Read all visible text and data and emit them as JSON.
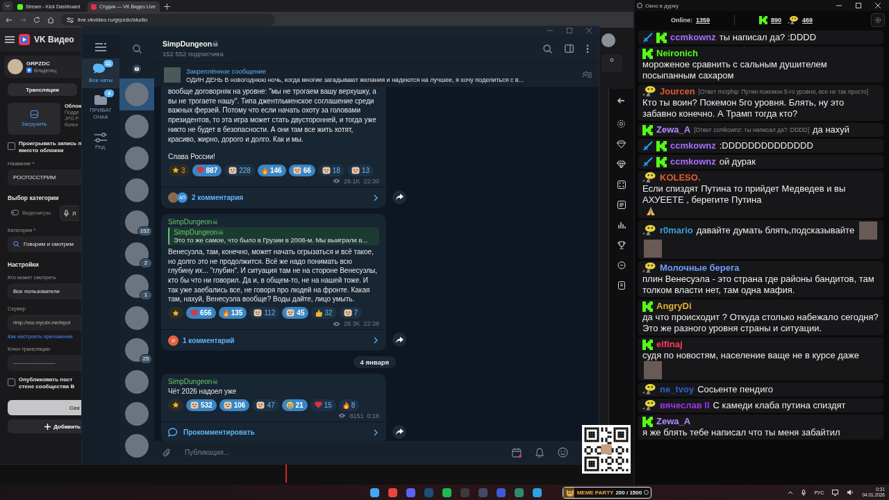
{
  "browser": {
    "tabs": [
      {
        "title": "Stream - Kick Dashboard",
        "selected": false,
        "kind": "kick"
      },
      {
        "title": "Студия — VK Видео Live",
        "selected": true,
        "kind": "vk"
      }
    ],
    "url": "live.vkvideo.ru/grpzdc/studio",
    "studio": {
      "brand": "VK Видео",
      "channel": "GRPZDC",
      "role": "Владелец",
      "section_tab": "Трансляции",
      "upload": "Загрузить",
      "cover_title": "Облож",
      "cover_hint": [
        "Подде",
        "JPG Р",
        "более"
      ],
      "play_recording": {
        "lines": [
          "Проигрывать запись п",
          "вместо обложки"
        ],
        "checked": false
      },
      "name_label": "Название *",
      "name_value": "РОСГОССТРИМ",
      "category_heading": "Выбор категории",
      "category_tabs": [
        {
          "label": "Видеоигры",
          "kind": "games",
          "selected": false
        },
        {
          "label": "Л",
          "kind": "live",
          "selected": true
        }
      ],
      "category_label": "Категория *",
      "category_value": "Говорим и смотрим",
      "settings_heading": "Настройки",
      "who_label": "Кто может смотреть",
      "who_value": "Все пользователи",
      "server_label": "Сервер",
      "server_value": "rtmp://vsu.mycdn.me/input",
      "help_link": "Как настроить приложение",
      "key_label": "Ключ трансляции",
      "key_value": "--------------------------",
      "publish": {
        "lines": [
          "Опубликовать пост",
          "стене сообщества В"
        ],
        "checked": false
      },
      "save_button": "Сох",
      "add_button": "Добавить"
    },
    "side_counter": "0"
  },
  "telegram": {
    "folders": [
      {
        "label": "Все чаты",
        "badge": "11",
        "kind": "chats",
        "selected": true
      },
      {
        "label": "ПРИВАТ ОЧКА",
        "badge": "4",
        "kind": "folder",
        "selected": false
      },
      {
        "label": "Ред.",
        "kind": "edit",
        "selected": false
      }
    ],
    "chats": [
      {
        "selected": true
      },
      {
        "selected": false
      },
      {
        "selected": false
      },
      {
        "selected": false
      },
      {
        "selected": false,
        "badge": "152"
      },
      {
        "selected": false,
        "badge": "2"
      },
      {
        "selected": false,
        "badge": "1"
      },
      {
        "selected": false
      },
      {
        "selected": false,
        "badge": "25"
      },
      {
        "selected": false
      },
      {
        "selected": false
      },
      {
        "selected": false
      }
    ],
    "title": "SimpDungeon☠",
    "subtitle": "152 552 подписчика",
    "pinned_label": "Закреплённое сообщение",
    "pinned_text": "ОДИН ДЕНЬ  В новогоднюю ночь, когда многие загадывают желания и надеются на лучшее, я хочу поделиться с в...",
    "messages": [
      {
        "kind": "message",
        "paragraphs": [
          "вообще договорняк на уровне: \"мы не трогаем вашу верхушку, а вы не трогаете нашу\". Типа джентльменское соглашение среди важных ферзей. Потому что если начать охоту за головами президентов, то эта игра может стать двусторонней, и тогда уже никто не будет в безопасности. А они там все жить хотят, красиво, жирно, дорого и долго. Как и мы.",
          "Слава России!"
        ],
        "reactions": [
          {
            "kind": "star",
            "count": "3"
          },
          {
            "kind": "heart",
            "count": "887",
            "selected": true
          },
          {
            "kind": "sticker",
            "count": "228",
            "selected": false
          },
          {
            "kind": "fire",
            "count": "146",
            "selected": true
          },
          {
            "kind": "sticker",
            "count": "66",
            "selected": true
          },
          {
            "kind": "sticker",
            "count": "18",
            "selected": false
          },
          {
            "kind": "sticker",
            "count": "13",
            "selected": false
          }
        ],
        "views": "29.1K",
        "time": "22:30",
        "comments": "2 комментария",
        "commenters": [
          {
            "kind": "photo"
          },
          {
            "kind": "initials",
            "text": "АП",
            "color": "#3a8fd8"
          }
        ]
      },
      {
        "kind": "message",
        "author": "SimpDungeon☠",
        "quote": {
          "author": "SimpDungeon☠",
          "text": "Это то же самое, что было в Грузии в 2008-м. Мы выиграли в..."
        },
        "paragraphs": [
          "Венесуэла, там, конечно, может начать огрызаться и всё такое, но долго это не продолжится. Всё же надо понимать всю глубину их... \"глубин\". И ситуация там не на стороне Венесуэлы, кто бы что ни говорил. Да и, в общем-то, не на нашей тоже. И так уже заебались все, не говоря про людей на фронте. Какая там, нахуй, Венесуэла вообще? Воды дайте, лицо умыть."
        ],
        "reactions": [
          {
            "kind": "star"
          },
          {
            "kind": "heart",
            "count": "656",
            "selected": true
          },
          {
            "kind": "fire",
            "count": "135",
            "selected": true
          },
          {
            "kind": "sticker",
            "count": "112",
            "selected": false
          },
          {
            "kind": "sticker",
            "count": "45",
            "selected": true
          },
          {
            "kind": "thumbs",
            "count": "32",
            "selected": false
          },
          {
            "kind": "sticker",
            "count": "7",
            "selected": false
          }
        ],
        "views": "28.3K",
        "time": "22:38",
        "comments": "1 комментарий",
        "commenters": [
          {
            "kind": "initials",
            "text": "И",
            "color": "#e5603f"
          }
        ]
      },
      {
        "kind": "date",
        "text": "4 января"
      },
      {
        "kind": "message",
        "author": "SimpDungeon☠",
        "paragraphs": [
          "Чёт 2026 надоел уже"
        ],
        "reactions": [
          {
            "kind": "star"
          },
          {
            "kind": "sticker",
            "count": "532",
            "selected": true
          },
          {
            "kind": "sticker",
            "count": "106",
            "selected": true
          },
          {
            "kind": "sticker",
            "count": "47",
            "selected": false
          },
          {
            "kind": "crying",
            "count": "21",
            "selected": true
          },
          {
            "kind": "heart",
            "count": "15",
            "selected": false
          },
          {
            "kind": "fire",
            "count": "8",
            "selected": false
          }
        ],
        "views": "8151",
        "time": "0:18",
        "comments": "Прокомментировать"
      }
    ],
    "input_placeholder": "Публикация..."
  },
  "chat_window": {
    "title": "Окно в дурку",
    "online_label": "Online:",
    "online": "1359",
    "platform_counts": [
      {
        "kind": "kick",
        "count": "890"
      },
      {
        "kind": "vk",
        "count": "469"
      }
    ],
    "messages": [
      {
        "user": "ccmkownz",
        "color": "#a970ff",
        "kind": "kick",
        "moderator": true,
        "text": "ты написал да? :DDDD"
      },
      {
        "user": "Neironich",
        "color": "#53fc18",
        "kind": "kick",
        "moderator": false,
        "text": "мороженое сравнить с сальным душителем посыпанным сахаром"
      },
      {
        "user": "Jourcen",
        "color": "#e35b2e",
        "kind": "vk",
        "moderator": false,
        "reply": "[Ответ mεrphψ: Путин покемон 5-го уровня, все не так просто]",
        "text": "Кто ты воин? Покемон 5го уровня. Блять, ну это забавно конечно. А Трамп тогда кто?"
      },
      {
        "user": "Zewa_A",
        "color": "#b48cff",
        "kind": "kick",
        "moderator": false,
        "reply": "[Ответ ccmkownz: ты написал да? :DDDD]",
        "text": "да нахуй"
      },
      {
        "user": "ccmkownz",
        "color": "#a970ff",
        "kind": "kick",
        "moderator": true,
        "text": ":DDDDDDDDDDDDDD"
      },
      {
        "user": "ccmkownz",
        "color": "#a970ff",
        "kind": "kick",
        "moderator": true,
        "text": "ой дурак"
      },
      {
        "user": "KOLESO.",
        "color": "#e35b2e",
        "kind": "vk",
        "moderator": false,
        "text": "Если спиздят Путина то прийдет Медведев и вы АХУЕЕТЕ , берегите Путина",
        "emotes": [
          {
            "kind": "hands"
          }
        ]
      },
      {
        "user": "r0mario",
        "color": "#3aa0d8",
        "kind": "vk",
        "moderator": false,
        "text": "давайте думать блять,подсказывайте",
        "emotes": [
          {
            "kind": "photo"
          },
          {
            "kind": "photo"
          }
        ]
      },
      {
        "user": "Молочные берега",
        "color": "#6f9cff",
        "kind": "vk",
        "moderator": false,
        "text": "плин Венесуэла - это страна где районы бандитов, там толком власти нет, там одна мафия."
      },
      {
        "user": "AngryDi",
        "color": "#e8b030",
        "kind": "kick",
        "moderator": false,
        "text": "да что происходит ? Откуда столько набежало сегодня? Это же разного уровня страны и ситуации."
      },
      {
        "user": "elfinaj",
        "color": "#ff3b5c",
        "kind": "kick",
        "moderator": false,
        "text": "судя по новостям, население ваще не в курсе даже",
        "emotes": [
          {
            "kind": "photo"
          }
        ]
      },
      {
        "user": "ne_tvoy",
        "color": "#2a62d0",
        "kind": "vk",
        "moderator": false,
        "text": "Сосьенте пендиго"
      },
      {
        "user": "вячеслав ll",
        "color": "#9a35e8",
        "kind": "vk",
        "moderator": false,
        "text": "С камеди клаба путина спиздят"
      },
      {
        "user": "Zewa_A",
        "color": "#b48cff",
        "kind": "kick",
        "moderator": false,
        "text": "я же блять тебе написал что ты меня забайтил"
      }
    ]
  },
  "taskbar": {
    "widget": {
      "title": "MEME PARTY",
      "progress": "200 / 1500",
      "level": 0.13
    },
    "language": "РУС",
    "time": "0:31",
    "date": "04.01.2026"
  }
}
